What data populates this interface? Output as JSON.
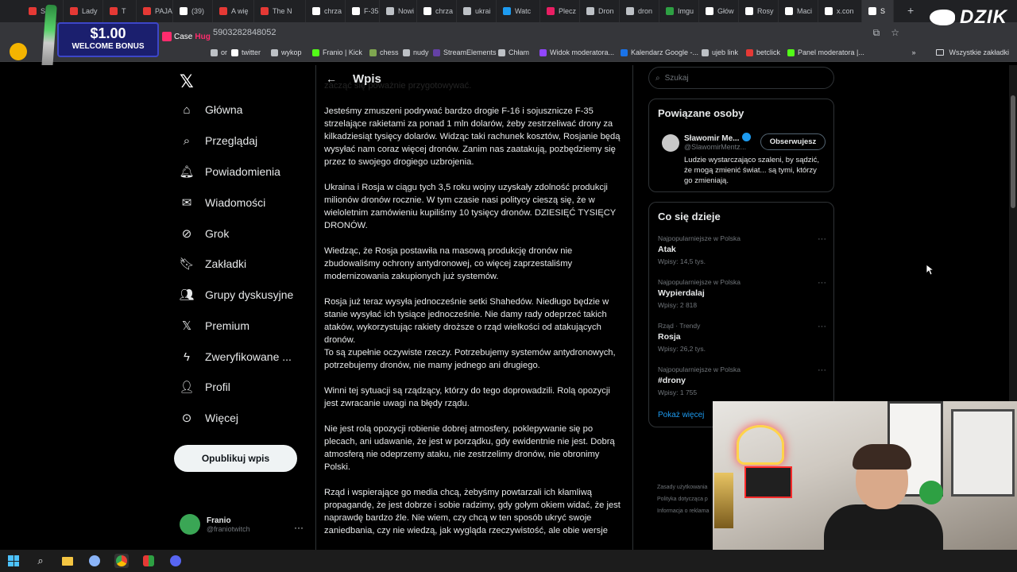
{
  "browser": {
    "tabs": [
      {
        "label": "SB",
        "color": "#e53935"
      },
      {
        "label": "Lady",
        "color": "#e53935"
      },
      {
        "label": "T",
        "color": "#e53935"
      },
      {
        "label": "PAJA",
        "color": "#e53935"
      },
      {
        "label": "(39)",
        "color": "#ffffff"
      },
      {
        "label": "A wię",
        "color": "#e53935"
      },
      {
        "label": "The N",
        "color": "#e53935"
      },
      {
        "label": "chrza",
        "color": "#ffffff"
      },
      {
        "label": "F-35",
        "color": "#ffffff"
      },
      {
        "label": "Nowi",
        "color": "#bdc1c6"
      },
      {
        "label": "chrza",
        "color": "#ffffff"
      },
      {
        "label": "ukrai",
        "color": "#bdc1c6"
      },
      {
        "label": "Watc",
        "color": "#1d9bf0"
      },
      {
        "label": "Plecz",
        "color": "#e91e63"
      },
      {
        "label": "Dron",
        "color": "#bdc1c6"
      },
      {
        "label": "dron",
        "color": "#bdc1c6"
      },
      {
        "label": "Imgu",
        "color": "#2ea043"
      },
      {
        "label": "Głów",
        "color": "#ffffff"
      },
      {
        "label": "Rosy",
        "color": "#ffffff"
      },
      {
        "label": "Maci",
        "color": "#ffffff"
      },
      {
        "label": "x.con",
        "color": "#ffffff"
      },
      {
        "label": "S",
        "color": "#ffffff"
      }
    ],
    "new_tab": "+",
    "url_fragment": "5903282848052",
    "bookmarks": [
      {
        "label": "or",
        "color": "#bdc1c6"
      },
      {
        "label": "twitter",
        "color": "#ffffff"
      },
      {
        "label": "wykop",
        "color": "#bdc1c6"
      },
      {
        "label": "Franio | Kick",
        "color": "#53fc18"
      },
      {
        "label": "chess",
        "color": "#7fa650"
      },
      {
        "label": "nudy",
        "color": "#bdc1c6"
      },
      {
        "label": "StreamElements",
        "color": "#6441a5"
      },
      {
        "label": "Chłam",
        "color": "#bdc1c6"
      },
      {
        "label": "Widok moderatora...",
        "color": "#9146ff"
      },
      {
        "label": "Kalendarz Google -...",
        "color": "#1a73e8"
      },
      {
        "label": "ujeb link",
        "color": "#bdc1c6"
      },
      {
        "label": "betclick",
        "color": "#e53935"
      },
      {
        "label": "Panel moderatora |...",
        "color": "#53fc18"
      }
    ],
    "bookmarks_more": "»",
    "all_bookmarks": "Wszystkie zakładki"
  },
  "ad": {
    "amount": "$1.00",
    "subtitle": "WELCOME BONUS",
    "logo_a": "Case",
    "logo_b": "Hug"
  },
  "brand": "DZIK",
  "nav": {
    "items": [
      {
        "label": "Główna",
        "icon": "home-icon"
      },
      {
        "label": "Przeglądaj",
        "icon": "search-icon"
      },
      {
        "label": "Powiadomienia",
        "icon": "bell-icon"
      },
      {
        "label": "Wiadomości",
        "icon": "mail-icon"
      },
      {
        "label": "Grok",
        "icon": "grok-icon"
      },
      {
        "label": "Zakładki",
        "icon": "bookmark-icon"
      },
      {
        "label": "Grupy dyskusyjne",
        "icon": "people-icon"
      },
      {
        "label": "Premium",
        "icon": "x-icon"
      },
      {
        "label": "Zweryfikowane ...",
        "icon": "lightning-icon"
      },
      {
        "label": "Profil",
        "icon": "person-icon"
      },
      {
        "label": "Więcej",
        "icon": "more-icon"
      }
    ],
    "post_button": "Opublikuj wpis",
    "user": {
      "name": "Franio",
      "handle": "@franiotwitch"
    }
  },
  "main": {
    "title": "Wpis",
    "paragraphs": [
      "zacząć się poważnie przygotowywać.",
      "Jesteśmy zmuszeni podrywać bardzo drogie F-16 i sojusznicze F-35 strzelające rakietami za ponad 1 mln dolarów, żeby zestrzeliwać drony za kilkadziesiąt tysięcy dolarów. Widząc taki rachunek kosztów, Rosjanie będą wysyłać nam coraz więcej dronów. Zanim nas zaatakują, pozbędziemy się przez to swojego drogiego uzbrojenia.",
      "Ukraina i Rosja w ciągu tych 3,5 roku wojny uzyskały zdolność produkcji milionów dronów rocznie. W tym czasie nasi politycy cieszą się, że w wieloletnim zamówieniu kupiliśmy 10 tysięcy dronów. DZIESIĘĆ TYSIĘCY DRONÓW.",
      "Wiedząc, że Rosja postawiła na masową produkcję dronów nie zbudowaliśmy ochrony antydronowej, co więcej zaprzestaliśmy modernizowania zakupionych już systemów.",
      "Rosja już teraz wysyła jednocześnie setki Shahedów. Niedługo będzie w stanie wysyłać ich tysiące jednocześnie. Nie damy rady odeprzeć takich ataków, wykorzystując rakiety droższe o rząd wielkości od atakujących dronów.\nTo są zupełnie oczywiste rzeczy. Potrzebujemy systemów antydronowych, potrzebujemy dronów, nie mamy jednego ani drugiego.",
      "Winni tej sytuacji są rządzący, którzy do tego doprowadzili. Rolą opozycji jest zwracanie uwagi na błędy rządu.",
      "Nie jest rolą opozycji robienie dobrej atmosfery, poklepywanie się po plecach, ani udawanie, że jest w porządku, gdy ewidentnie nie jest. Dobrą atmosferą nie odeprzemy ataku, nie zestrzelimy dronów, nie obronimy Polski.",
      "Rząd i wspierające go media chcą, żebyśmy powtarzali ich kłamliwą propagandę, że jest dobrze i sobie radzimy, gdy gołym okiem widać, że jest naprawdę bardzo źle. Nie wiem, czy chcą w ten sposób ukryć swoje zaniedbania, czy nie wiedzą, jak wygląda rzeczywistość, ale obie wersje"
    ]
  },
  "right": {
    "search_placeholder": "Szukaj",
    "related_title": "Powiązane osoby",
    "person": {
      "name": "Sławomir Me...",
      "handle": "@SlawomirMentz...",
      "follow_label": "Obserwujesz",
      "bio": "Ludzie wystarczająco szaleni, by sądzić, że mogą zmienić świat... są tymi, którzy go zmieniają."
    },
    "trends_title": "Co się dzieje",
    "trends": [
      {
        "context": "Najpopularniejsze w Polska",
        "name": "Atak",
        "count": "Wpisy: 14,5 tys."
      },
      {
        "context": "Najpopularniejsze w Polska",
        "name": "Wypierdalaj",
        "count": "Wpisy: 2 818"
      },
      {
        "context": "Rząd · Trendy",
        "name": "Rosja",
        "count": "Wpisy: 26,2 tys."
      },
      {
        "context": "Najpopularniejsze w Polska",
        "name": "#drony",
        "count": "Wpisy: 1 755"
      }
    ],
    "show_more": "Pokaż więcej",
    "footer": [
      "Zasady użytkowania",
      "Polityka dotycząca p",
      "Informacja o reklama"
    ]
  },
  "colors": {
    "accent": "#1d9bf0",
    "background": "#000000",
    "text": "#e7e9ea",
    "muted": "#71767b"
  }
}
